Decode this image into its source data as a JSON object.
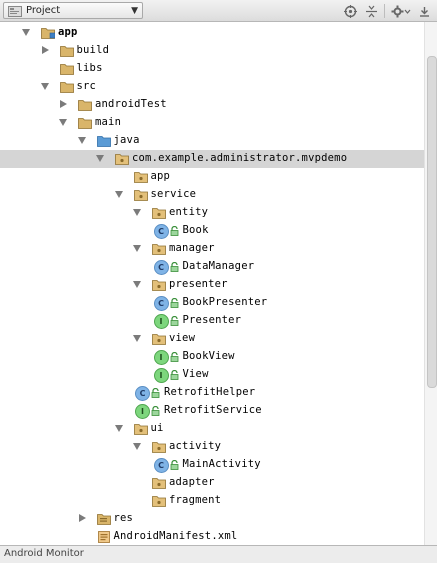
{
  "toolbar": {
    "view_selector": "Project",
    "icons": [
      "target-icon",
      "collapse-all-icon",
      "gear-icon",
      "hide-icon"
    ]
  },
  "colors": {
    "folder": "#d9b56a",
    "source_folder": "#5b9bd5",
    "class_icon": "#7fb3e6",
    "interface_icon": "#7dd67d",
    "selection": "#d5d5d5"
  },
  "tree": [
    {
      "label": "app",
      "icon": "module-folder-icon",
      "expanded": true,
      "bold": true
    },
    {
      "label": "build",
      "icon": "folder-icon",
      "expanded": false
    },
    {
      "label": "libs",
      "icon": "folder-icon"
    },
    {
      "label": "src",
      "icon": "folder-icon",
      "expanded": true
    },
    {
      "label": "androidTest",
      "icon": "folder-icon",
      "expanded": false
    },
    {
      "label": "main",
      "icon": "folder-icon",
      "expanded": true
    },
    {
      "label": "java",
      "icon": "source-folder-icon",
      "expanded": true
    },
    {
      "label": "com.example.administrator.mvpdemo",
      "icon": "package-icon",
      "expanded": true,
      "selected": true
    },
    {
      "label": "app",
      "icon": "package-icon"
    },
    {
      "label": "service",
      "icon": "package-icon",
      "expanded": true
    },
    {
      "label": "entity",
      "icon": "package-icon",
      "expanded": true
    },
    {
      "label": "Book",
      "icon": "class-icon"
    },
    {
      "label": "manager",
      "icon": "package-icon",
      "expanded": true
    },
    {
      "label": "DataManager",
      "icon": "class-icon"
    },
    {
      "label": "presenter",
      "icon": "package-icon",
      "expanded": true
    },
    {
      "label": "BookPresenter",
      "icon": "class-icon"
    },
    {
      "label": "Presenter",
      "icon": "interface-icon"
    },
    {
      "label": "view",
      "icon": "package-icon",
      "expanded": true
    },
    {
      "label": "BookView",
      "icon": "interface-icon"
    },
    {
      "label": "View",
      "icon": "interface-icon"
    },
    {
      "label": "RetrofitHelper",
      "icon": "class-icon"
    },
    {
      "label": "RetrofitService",
      "icon": "interface-icon"
    },
    {
      "label": "ui",
      "icon": "package-icon",
      "expanded": true
    },
    {
      "label": "activity",
      "icon": "package-icon",
      "expanded": true
    },
    {
      "label": "MainActivity",
      "icon": "class-icon"
    },
    {
      "label": "adapter",
      "icon": "package-icon"
    },
    {
      "label": "fragment",
      "icon": "package-icon"
    },
    {
      "label": "res",
      "icon": "resource-folder-icon",
      "expanded": false
    },
    {
      "label": "AndroidManifest.xml",
      "icon": "manifest-icon"
    }
  ],
  "bottom_bar": {
    "tool_window": "Android Monitor"
  }
}
